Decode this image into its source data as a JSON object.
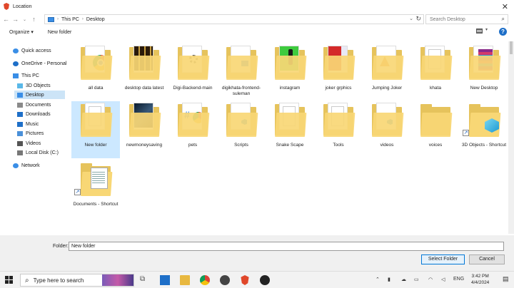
{
  "window": {
    "title": "Location",
    "close": "✕"
  },
  "address": {
    "crumbs": [
      "This PC",
      "Desktop"
    ],
    "search_placeholder": "Search Desktop"
  },
  "commands": {
    "organize": "Organize ▾",
    "new_folder": "New folder"
  },
  "nav": [
    {
      "label": "Quick access",
      "icon": "star-icon",
      "color": "#3a8ee6"
    },
    {
      "label": "OneDrive - Personal",
      "icon": "cloud-icon",
      "color": "#1e6fc8"
    },
    {
      "label": "This PC",
      "icon": "computer-icon",
      "color": "#3a8ee6"
    },
    {
      "label": "3D Objects",
      "icon": "cube-icon",
      "color": "#5ab8e8"
    },
    {
      "label": "Desktop",
      "icon": "desktop-icon",
      "color": "#3a8ee6"
    },
    {
      "label": "Documents",
      "icon": "document-icon",
      "color": "#8a8a8a"
    },
    {
      "label": "Downloads",
      "icon": "download-icon",
      "color": "#1e6fc8"
    },
    {
      "label": "Music",
      "icon": "music-icon",
      "color": "#1e6fc8"
    },
    {
      "label": "Pictures",
      "icon": "picture-icon",
      "color": "#4a90d9"
    },
    {
      "label": "Videos",
      "icon": "video-icon",
      "color": "#555555"
    },
    {
      "label": "Local Disk (C:)",
      "icon": "disk-icon",
      "color": "#777777"
    },
    {
      "label": "Network",
      "icon": "network-icon",
      "color": "#3a8ee6"
    }
  ],
  "items": [
    {
      "label": "all data",
      "thumb": "chrome"
    },
    {
      "label": "desktop data latest",
      "thumb": "dark-grid"
    },
    {
      "label": "Digi-Backend-main",
      "thumb": "gear"
    },
    {
      "label": "digikhata-frontend-suleman",
      "thumb": "docs"
    },
    {
      "label": "instagram",
      "thumb": "green"
    },
    {
      "label": "joker grphics",
      "thumb": "red"
    },
    {
      "label": "Jumping Joker",
      "thumb": "vlc"
    },
    {
      "label": "khata",
      "thumb": "plain"
    },
    {
      "label": "New Desktop",
      "thumb": "colorful"
    },
    {
      "label": "New folder",
      "thumb": "plain",
      "selected": true
    },
    {
      "label": "newmoneysaving",
      "thumb": "dark-photo"
    },
    {
      "label": "pets",
      "thumb": "hash-chrome"
    },
    {
      "label": "Scripts",
      "thumb": "vscode"
    },
    {
      "label": "Snake Scape",
      "thumb": "plain"
    },
    {
      "label": "Tools",
      "thumb": "plain"
    },
    {
      "label": "videos",
      "thumb": "vscode"
    },
    {
      "label": "voices",
      "thumb": "empty"
    },
    {
      "label": "3D Objects - Shortcut",
      "thumb": "cube",
      "shortcut": true
    },
    {
      "label": "Documents - Shortcut",
      "thumb": "doc",
      "shortcut": true
    }
  ],
  "footer": {
    "folder_label": "Folder:",
    "folder_value": "New folder",
    "select_button": "Select Folder",
    "cancel_button": "Cancel"
  },
  "taskbar": {
    "search_placeholder": "Type here to search",
    "lang": "ENG",
    "time": "3:42 PM",
    "date": "4/4/2024"
  }
}
